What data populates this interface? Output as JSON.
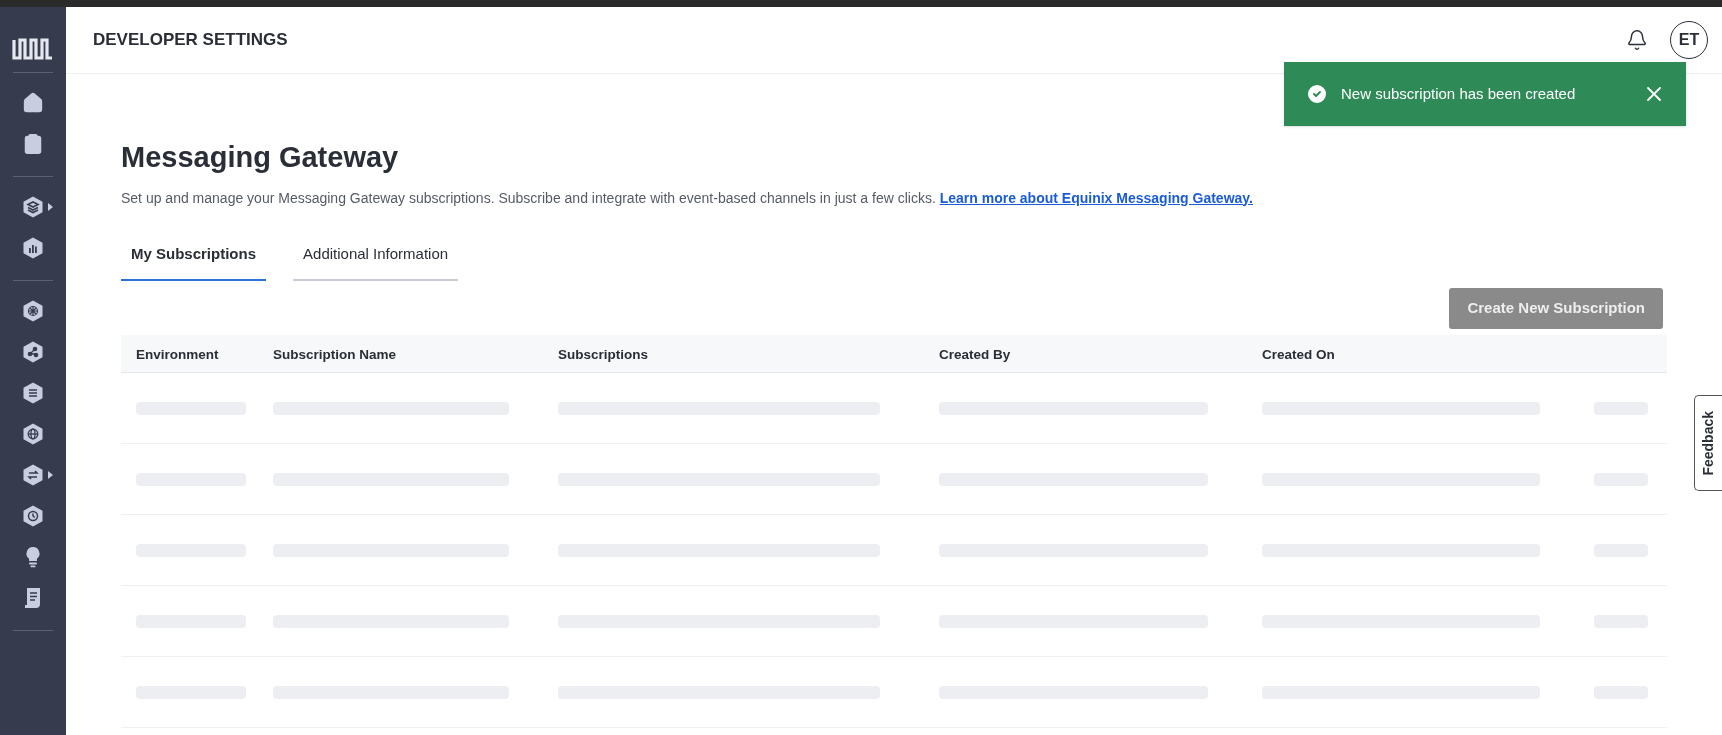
{
  "sidebar": {
    "groups": [
      {
        "items": [
          {
            "kind": "home",
            "expandable": false
          },
          {
            "kind": "clipboard",
            "expandable": false
          }
        ]
      },
      {
        "items": [
          {
            "kind": "layers",
            "expandable": true
          },
          {
            "kind": "chart",
            "expandable": false
          }
        ]
      },
      {
        "items": [
          {
            "kind": "network",
            "expandable": false
          },
          {
            "kind": "share",
            "expandable": false
          },
          {
            "kind": "stream",
            "expandable": false
          },
          {
            "kind": "globe",
            "expandable": false
          },
          {
            "kind": "exchange",
            "expandable": true
          },
          {
            "kind": "clock",
            "expandable": false
          },
          {
            "kind": "bulb",
            "expandable": false
          },
          {
            "kind": "document",
            "expandable": false
          }
        ]
      }
    ]
  },
  "header": {
    "title": "DEVELOPER SETTINGS",
    "avatar": "ET"
  },
  "toast": {
    "message": "New subscription has been created"
  },
  "page": {
    "title": "Messaging Gateway",
    "description": "Set up and manage your Messaging Gateway subscriptions. Subscribe and integrate with event-based channels in just a few clicks.",
    "link": "Learn more about Equinix Messaging Gateway."
  },
  "tabs": [
    {
      "label": "My Subscriptions",
      "selected": true
    },
    {
      "label": "Additional Information",
      "selected": false
    }
  ],
  "create_button": {
    "label": "Create New Subscription",
    "disabled": true
  },
  "table": {
    "columns": [
      "Environment",
      "Subscription Name",
      "Subscriptions",
      "Created By",
      "Created On"
    ],
    "loading": true
  },
  "feedback": {
    "label": "Feedback"
  }
}
